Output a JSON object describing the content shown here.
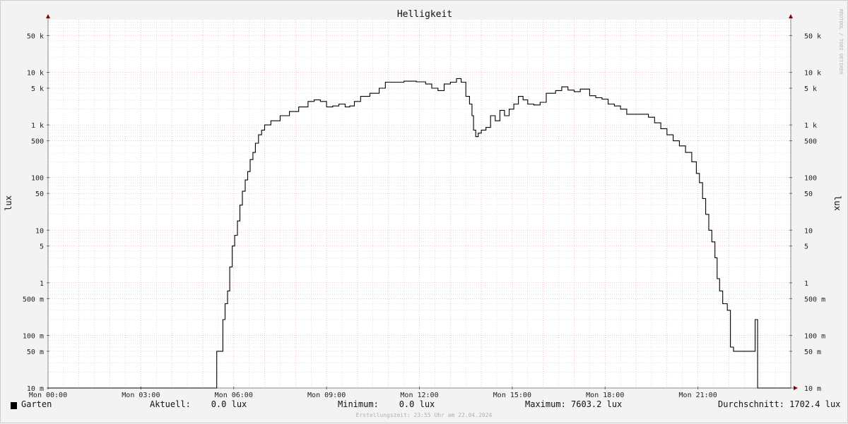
{
  "chart_data": {
    "type": "line",
    "title": "Helligkeit",
    "ylabel": "lux",
    "ylabel_right": "lux",
    "watermark": "RRDTOOL / TOBI OETIKER",
    "x_ticks": [
      "Mon 00:00",
      "Mon 03:00",
      "Mon 06:00",
      "Mon 09:00",
      "Mon 12:00",
      "Mon 15:00",
      "Mon 18:00",
      "Mon 21:00"
    ],
    "x_hours": [
      0,
      3,
      6,
      9,
      12,
      15,
      18,
      21
    ],
    "xlim_hours": [
      0,
      24
    ],
    "y_scale": "log",
    "ylim": [
      0.01,
      100000
    ],
    "y_ticks": [
      {
        "v": 0.01,
        "label": "10 m"
      },
      {
        "v": 0.05,
        "label": "50 m"
      },
      {
        "v": 0.1,
        "label": "100 m"
      },
      {
        "v": 0.5,
        "label": "500 m"
      },
      {
        "v": 1,
        "label": "1"
      },
      {
        "v": 5,
        "label": "5"
      },
      {
        "v": 10,
        "label": "10"
      },
      {
        "v": 50,
        "label": "50"
      },
      {
        "v": 100,
        "label": "100"
      },
      {
        "v": 500,
        "label": "500"
      },
      {
        "v": 1000,
        "label": "1 k"
      },
      {
        "v": 5000,
        "label": "5 k"
      },
      {
        "v": 10000,
        "label": "10 k"
      },
      {
        "v": 50000,
        "label": "50 k"
      }
    ],
    "grid": true,
    "series": [
      {
        "name": "Garten",
        "color": "#000000",
        "points": [
          [
            0,
            0.01
          ],
          [
            5.43,
            0.01
          ],
          [
            5.45,
            0.05
          ],
          [
            5.6,
            0.05
          ],
          [
            5.65,
            0.2
          ],
          [
            5.72,
            0.4
          ],
          [
            5.8,
            0.7
          ],
          [
            5.87,
            2
          ],
          [
            5.95,
            5
          ],
          [
            6.03,
            8
          ],
          [
            6.12,
            15
          ],
          [
            6.2,
            30
          ],
          [
            6.28,
            55
          ],
          [
            6.37,
            90
          ],
          [
            6.45,
            130
          ],
          [
            6.53,
            220
          ],
          [
            6.62,
            300
          ],
          [
            6.7,
            450
          ],
          [
            6.8,
            650
          ],
          [
            6.9,
            800
          ],
          [
            7.0,
            1000
          ],
          [
            7.2,
            1200
          ],
          [
            7.5,
            1500
          ],
          [
            7.8,
            1800
          ],
          [
            8.1,
            2200
          ],
          [
            8.4,
            2800
          ],
          [
            8.6,
            3000
          ],
          [
            8.8,
            2800
          ],
          [
            9.0,
            2200
          ],
          [
            9.2,
            2300
          ],
          [
            9.4,
            2500
          ],
          [
            9.6,
            2200
          ],
          [
            9.75,
            2300
          ],
          [
            9.9,
            2800
          ],
          [
            10.1,
            3500
          ],
          [
            10.4,
            4000
          ],
          [
            10.7,
            5000
          ],
          [
            10.9,
            6500
          ],
          [
            11.2,
            6500
          ],
          [
            11.5,
            6800
          ],
          [
            11.9,
            6600
          ],
          [
            12.2,
            6000
          ],
          [
            12.4,
            5000
          ],
          [
            12.6,
            4500
          ],
          [
            12.8,
            6000
          ],
          [
            13.0,
            6500
          ],
          [
            13.2,
            7603
          ],
          [
            13.35,
            6500
          ],
          [
            13.5,
            3500
          ],
          [
            13.62,
            2500
          ],
          [
            13.7,
            1500
          ],
          [
            13.75,
            800
          ],
          [
            13.82,
            600
          ],
          [
            13.9,
            700
          ],
          [
            14.0,
            800
          ],
          [
            14.15,
            900
          ],
          [
            14.3,
            1500
          ],
          [
            14.45,
            1200
          ],
          [
            14.6,
            1900
          ],
          [
            14.75,
            1500
          ],
          [
            14.9,
            2000
          ],
          [
            15.05,
            2500
          ],
          [
            15.2,
            3500
          ],
          [
            15.35,
            3000
          ],
          [
            15.5,
            2500
          ],
          [
            15.7,
            2400
          ],
          [
            15.9,
            2700
          ],
          [
            16.1,
            4000
          ],
          [
            16.4,
            4500
          ],
          [
            16.6,
            5300
          ],
          [
            16.8,
            4600
          ],
          [
            17.0,
            4300
          ],
          [
            17.2,
            4800
          ],
          [
            17.5,
            3600
          ],
          [
            17.7,
            3300
          ],
          [
            17.9,
            3100
          ],
          [
            18.1,
            2500
          ],
          [
            18.3,
            2300
          ],
          [
            18.5,
            2000
          ],
          [
            18.7,
            1600
          ],
          [
            19.2,
            1600
          ],
          [
            19.4,
            1400
          ],
          [
            19.6,
            1100
          ],
          [
            19.8,
            850
          ],
          [
            20.0,
            650
          ],
          [
            20.2,
            500
          ],
          [
            20.4,
            400
          ],
          [
            20.6,
            300
          ],
          [
            20.8,
            200
          ],
          [
            20.95,
            120
          ],
          [
            21.05,
            80
          ],
          [
            21.15,
            40
          ],
          [
            21.25,
            20
          ],
          [
            21.35,
            10
          ],
          [
            21.45,
            6
          ],
          [
            21.55,
            3
          ],
          [
            21.62,
            1.2
          ],
          [
            21.7,
            0.7
          ],
          [
            21.8,
            0.4
          ],
          [
            21.95,
            0.3
          ],
          [
            22.05,
            0.06
          ],
          [
            22.15,
            0.05
          ],
          [
            22.6,
            0.05
          ],
          [
            22.82,
            0.05
          ],
          [
            22.85,
            0.2
          ],
          [
            22.9,
            0.2
          ],
          [
            22.93,
            0.01
          ],
          [
            24,
            0.01
          ]
        ]
      }
    ]
  },
  "legend": {
    "name": "Garten",
    "current": "Aktuell:    0.0 lux",
    "minimum": "Minimum:    0.0 lux",
    "maximum": "Maximum: 7603.2 lux",
    "average": "Durchschnitt: 1702.4 lux"
  },
  "footer": "Erstellungszeit: 23:55 Uhr am 22.04.2024",
  "colors": {
    "background": "#f3f3f3",
    "plot": "#ffffff",
    "major_grid": "#e6a0a0",
    "minor_grid": "#d0d0d0",
    "line": "#000000",
    "axis_arrow": "#8b0000"
  }
}
